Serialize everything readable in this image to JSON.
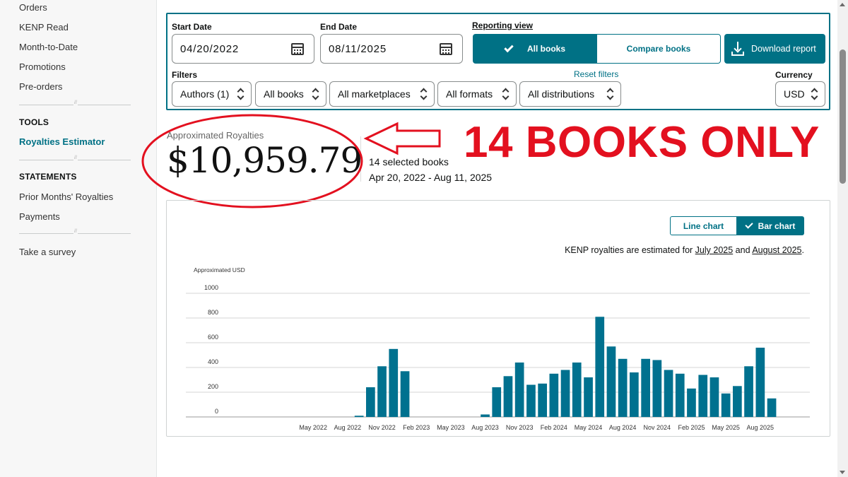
{
  "sidebar": {
    "items_top": [
      "Orders",
      "KENP Read",
      "Month-to-Date",
      "Promotions",
      "Pre-orders"
    ],
    "tools_header": "TOOLS",
    "tools_items": [
      "Royalties Estimator"
    ],
    "statements_header": "STATEMENTS",
    "statements_items": [
      "Prior Months' Royalties",
      "Payments"
    ],
    "survey": "Take a survey"
  },
  "filters": {
    "start_label": "Start Date",
    "start_value": "04/20/2022",
    "end_label": "End Date",
    "end_value": "08/11/2025",
    "reporting_label": "Reporting view",
    "all_books": "All books",
    "compare_books": "Compare books",
    "download": "Download report",
    "filters_label": "Filters",
    "reset": "Reset filters",
    "currency_label": "Currency",
    "authors": "Authors (1)",
    "books": "All books",
    "marketplaces": "All marketplaces",
    "formats": "All formats",
    "distributions": "All distributions",
    "currency": "USD"
  },
  "summary": {
    "label": "Approximated Royalties",
    "amount": "$10,959.79",
    "selected": "14 selected books",
    "range": "Apr 20, 2022 - Aug 11, 2025"
  },
  "annotation": {
    "headline": "14 BOOKS ONLY",
    "color": "#e3101f"
  },
  "chart_panel": {
    "line_chart": "Line chart",
    "bar_chart": "Bar chart",
    "kenp_prefix": "KENP royalties are estimated for ",
    "kenp_link1": "July 2025",
    "kenp_and": " and ",
    "kenp_link2": "August 2025",
    "kenp_suffix": "."
  },
  "chart_data": {
    "type": "bar",
    "ylabel": "Approximated USD",
    "ylim": [
      0,
      1000
    ],
    "yticks": [
      0,
      200,
      400,
      600,
      800,
      1000
    ],
    "grid": true,
    "bar_color": "#00718f",
    "x_tick_labels": [
      "May 2022",
      "Aug 2022",
      "Nov 2022",
      "Feb 2023",
      "May 2023",
      "Aug 2023",
      "Nov 2023",
      "Feb 2024",
      "May 2024",
      "Aug 2024",
      "Nov 2024",
      "Feb 2025",
      "May 2025",
      "Aug 2025"
    ],
    "categories": [
      "Apr 2022",
      "May 2022",
      "Jun 2022",
      "Jul 2022",
      "Aug 2022",
      "Sep 2022",
      "Oct 2022",
      "Nov 2022",
      "Dec 2022",
      "Jan 2023",
      "Feb 2023",
      "Mar 2023",
      "Apr 2023",
      "May 2023",
      "Jun 2023",
      "Jul 2023",
      "Aug 2023",
      "Sep 2023",
      "Oct 2023",
      "Nov 2023",
      "Dec 2023",
      "Jan 2024",
      "Feb 2024",
      "Mar 2024",
      "Apr 2024",
      "May 2024",
      "Jun 2024",
      "Jul 2024",
      "Aug 2024",
      "Sep 2024",
      "Oct 2024",
      "Nov 2024",
      "Dec 2024",
      "Jan 2025",
      "Feb 2025",
      "Mar 2025",
      "Apr 2025",
      "May 2025",
      "Jun 2025",
      "Jul 2025",
      "Aug 2025"
    ],
    "values": [
      0,
      0,
      0,
      0,
      0,
      10,
      240,
      410,
      550,
      370,
      0,
      0,
      0,
      0,
      0,
      0,
      20,
      240,
      330,
      440,
      260,
      270,
      350,
      380,
      440,
      320,
      810,
      570,
      470,
      360,
      470,
      460,
      380,
      350,
      230,
      340,
      320,
      190,
      250,
      410,
      560,
      150
    ]
  }
}
